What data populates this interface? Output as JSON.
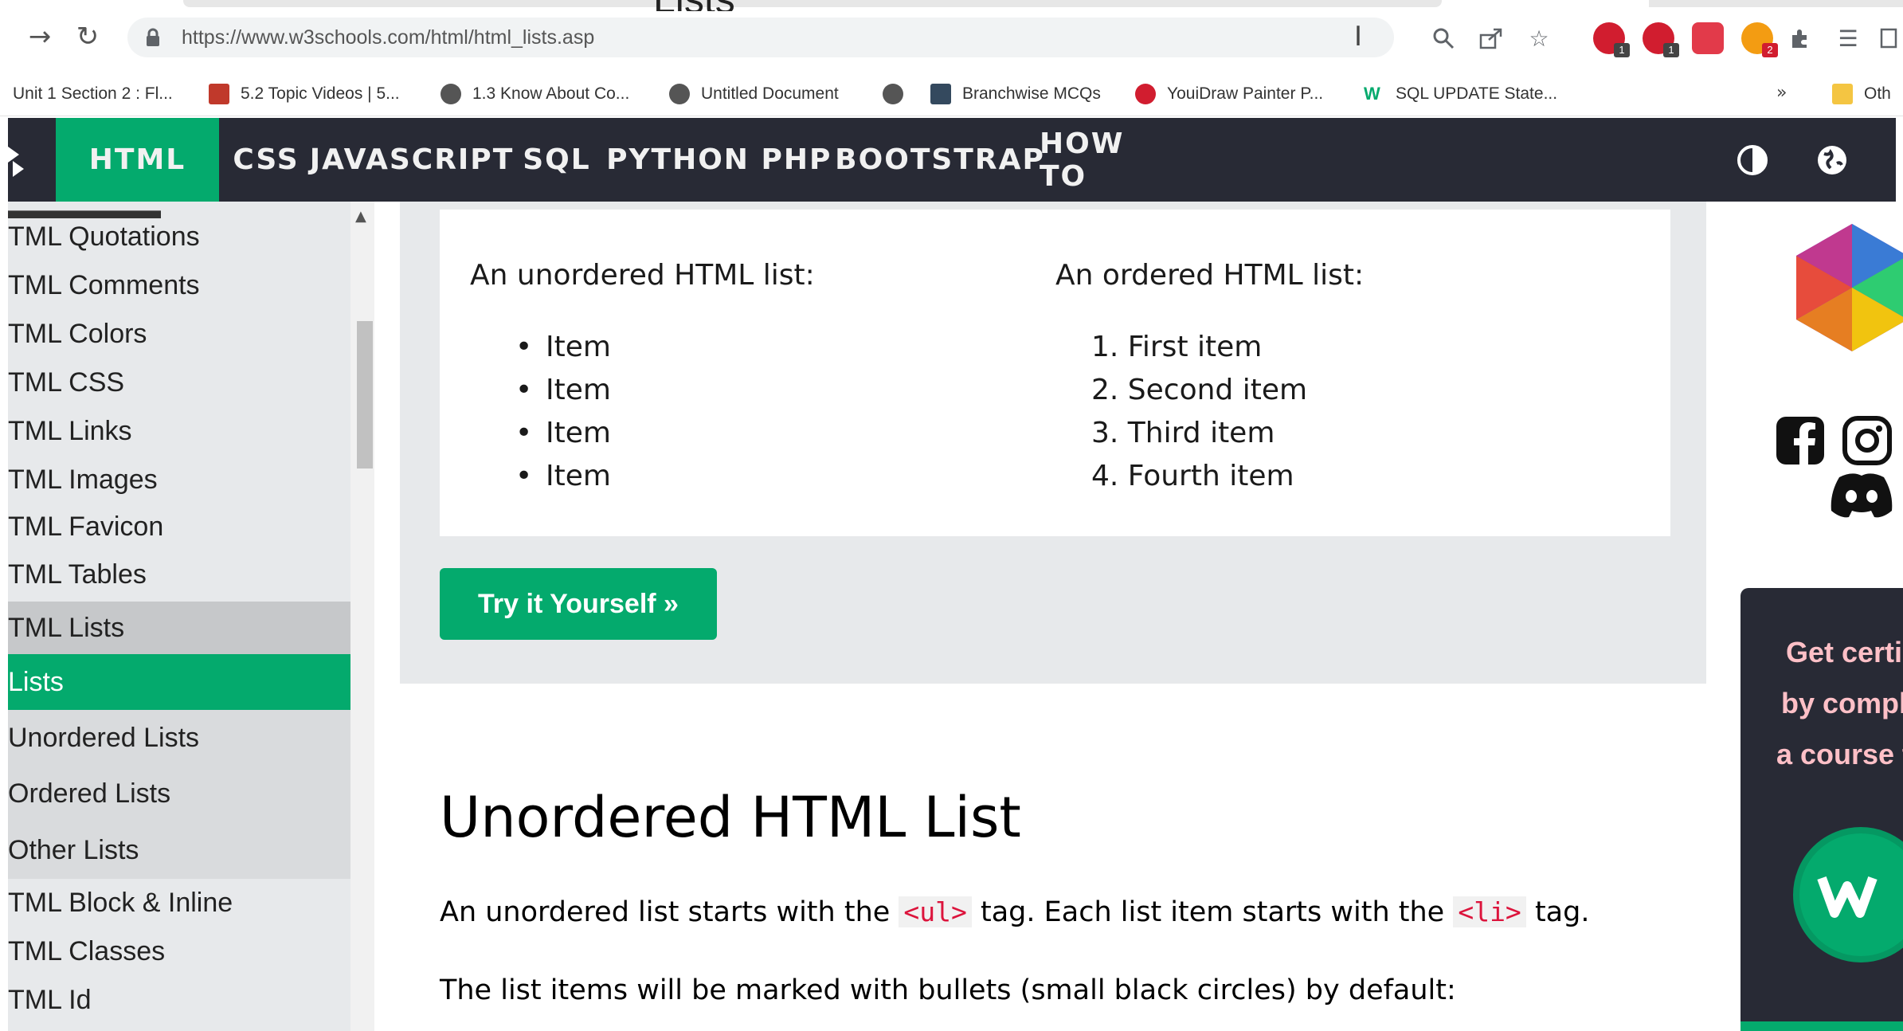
{
  "browser": {
    "tab_title": "Lists",
    "url": "https://www.w3schools.com/html/html_lists.asp",
    "bookmarks": [
      "Unit 1 Section 2 : Fl...",
      "5.2 Topic Videos | 5...",
      "1.3 Know About Co...",
      "Untitled Document",
      "",
      "Branchwise MCQs",
      "YouiDraw Painter P...",
      "SQL UPDATE State..."
    ],
    "bookmarks_more": "»",
    "other_bookmarks": "Oth",
    "extension_badges": [
      "1",
      "1",
      "2"
    ]
  },
  "nav": {
    "items": [
      "HTML",
      "CSS",
      "JAVASCRIPT",
      "SQL",
      "PYTHON",
      "PHP",
      "BOOTSTRAP",
      "HOW TO"
    ],
    "active": "HTML",
    "icons": [
      "contrast-icon",
      "globe-icon"
    ]
  },
  "sidebar": {
    "items": [
      {
        "label": "TML Quotations",
        "kind": "topic"
      },
      {
        "label": "TML Comments",
        "kind": "topic"
      },
      {
        "label": "TML Colors",
        "kind": "topic"
      },
      {
        "label": "TML CSS",
        "kind": "topic"
      },
      {
        "label": "TML Links",
        "kind": "topic"
      },
      {
        "label": "TML Images",
        "kind": "topic"
      },
      {
        "label": "TML Favicon",
        "kind": "topic"
      },
      {
        "label": "TML Tables",
        "kind": "topic"
      },
      {
        "label": "TML Lists",
        "kind": "current"
      },
      {
        "label": "Lists",
        "kind": "active"
      },
      {
        "label": "Unordered Lists",
        "kind": "sub"
      },
      {
        "label": "Ordered Lists",
        "kind": "sub"
      },
      {
        "label": "Other Lists",
        "kind": "sub"
      },
      {
        "label": "TML Block & Inline",
        "kind": "topic"
      },
      {
        "label": "TML Classes",
        "kind": "topic"
      },
      {
        "label": "TML Id",
        "kind": "topic"
      }
    ]
  },
  "example": {
    "unordered_heading": "An unordered HTML list:",
    "unordered_items": [
      "Item",
      "Item",
      "Item",
      "Item"
    ],
    "ordered_heading": "An ordered HTML list:",
    "ordered_items": [
      "1. First item",
      "2. Second item",
      "3. Third item",
      "4. Fourth item"
    ],
    "try_button": "Try it Yourself »"
  },
  "section": {
    "title": "Unordered HTML List",
    "p1_a": "An unordered list starts with the ",
    "p1_tag1": "<ul>",
    "p1_b": " tag. Each list item starts with the ",
    "p1_tag2": "<li>",
    "p1_c": " tag.",
    "p2": "The list items will be marked with bullets (small black circles) by default:"
  },
  "promo": {
    "lines": [
      "Get certi",
      "by compl",
      "a course t"
    ]
  },
  "colors": {
    "w3_green": "#04aa6d",
    "nav_dark": "#282a35",
    "sidebar_gray": "#e7e9eb",
    "code_red": "#dc143c"
  }
}
